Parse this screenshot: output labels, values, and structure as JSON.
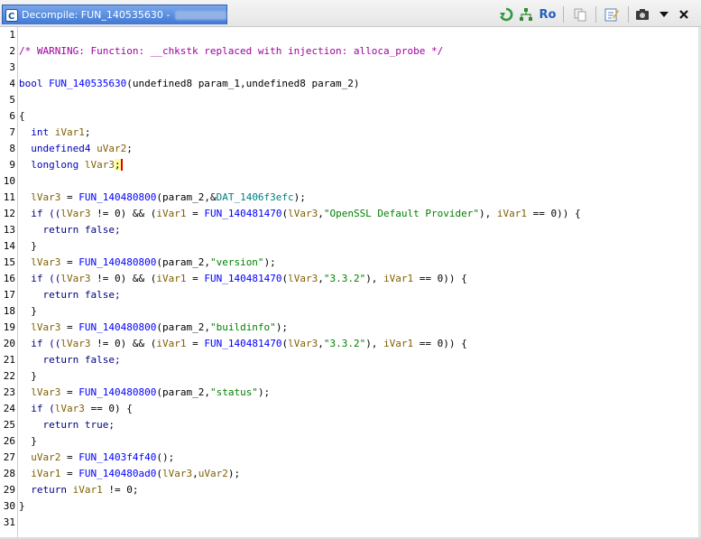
{
  "window": {
    "title": "Decompile: FUN_140535630 -",
    "colors": {
      "tab": "#3f78d6",
      "keyword": "#000080",
      "type": "#0000c0",
      "function": "#0000ff",
      "variable": "#806000",
      "string": "#008000",
      "comment": "#a000a0"
    }
  },
  "toolbar": {
    "refresh_icon": "refresh-icon",
    "graph_icon": "function-graph-icon",
    "ro_label": "Ro",
    "copy_icon": "copy-icon",
    "edit_icon": "edit-icon",
    "snapshot_icon": "camera-icon",
    "menu_icon": "dropdown-arrow-icon",
    "close_icon": "close-icon"
  },
  "code": {
    "line_numbers": [
      "1",
      "2",
      "3",
      "4",
      "5",
      "6",
      "7",
      "8",
      "9",
      "10",
      "11",
      "12",
      "13",
      "14",
      "15",
      "16",
      "17",
      "18",
      "19",
      "20",
      "21",
      "22",
      "23",
      "24",
      "25",
      "26",
      "27",
      "28",
      "29",
      "30",
      "31"
    ],
    "l2_comment": "/* WARNING: Function: __chkstk replaced with injection: alloca_probe */",
    "l4_type": "bool",
    "l4_name": "FUN_140535630",
    "l4_args": "(undefined8 param_1,undefined8 param_2)",
    "l6": "{",
    "l7_type": "int",
    "l7_var": "iVar1",
    "l8_type": "undefined4",
    "l8_var": "uVar2",
    "l9_type": "longlong",
    "l9_var": "lVar3",
    "semi": ";",
    "l11_var": "lVar3",
    "l11_fn": "FUN_140480800",
    "l11_args_a": "(param_2,&",
    "l11_glob": "DAT_1406f3efc",
    "l11_args_b": ");",
    "l12_a": "if ((",
    "l12_b": "lVar3",
    "l12_c": " != 0) && (",
    "l12_d": "iVar1",
    "l12_e": " = ",
    "l12_f": "FUN_140481470",
    "l12_g": "(",
    "l12_h": "lVar3",
    "l12_i": ",",
    "l12_str": "\"OpenSSL Default Provider\"",
    "l12_j": "), ",
    "l12_k": "iVar1",
    "l12_l": " == 0)) {",
    "ret_false": "return false;",
    "close_brace": "}",
    "l15_str": "\"version\"",
    "l16_str": "\"3.3.2\"",
    "l19_str": "\"buildinfo\"",
    "l20_str": "\"3.3.2\"",
    "l23_str": "\"status\"",
    "l24_a": "if (",
    "l24_b": " == 0) {",
    "ret_true": "return true;",
    "l27_fn": "FUN_1403f4f40",
    "l27_args": "();",
    "l28_fn": "FUN_140480ad0",
    "l28_args_a": "(",
    "l28_args_b": ",",
    "l28_args_c": ");",
    "l29_a": "return ",
    "l29_b": " != 0;",
    "param2": "param_2",
    "assign": " = ",
    "open_paren": "(",
    "comma": ",",
    "close_call": ");"
  }
}
